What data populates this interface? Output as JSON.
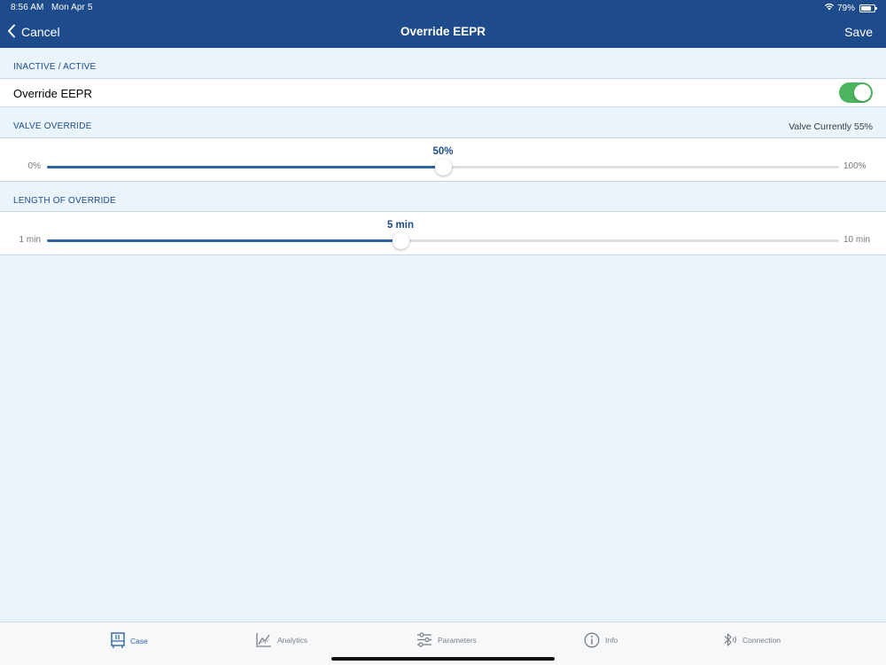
{
  "status_bar": {
    "time": "8:56 AM",
    "date": "Mon Apr 5",
    "battery": "79%",
    "battery_level": 0.79
  },
  "nav": {
    "back_label": "Cancel",
    "title": "Override EEPR",
    "save_label": "Save"
  },
  "sections": {
    "active": {
      "header": "INACTIVE / ACTIVE",
      "row_label": "Override EEPR",
      "toggle_on": true
    },
    "valve": {
      "header": "VALVE OVERRIDE",
      "status": "Valve Currently 55%",
      "slider": {
        "min_label": "0%",
        "max_label": "100%",
        "value_label": "50%",
        "fraction": 0.5
      }
    },
    "length": {
      "header": "LENGTH OF OVERRIDE",
      "slider": {
        "min_label": "1 min",
        "max_label": "10 min",
        "value_label": "5 min",
        "fraction": 0.4463
      }
    }
  },
  "tabs": [
    {
      "label": "Case",
      "icon": "case-icon",
      "active": true
    },
    {
      "label": "Analytics",
      "icon": "analytics-icon",
      "active": false
    },
    {
      "label": "Parameters",
      "icon": "parameters-icon",
      "active": false
    },
    {
      "label": "Info",
      "icon": "info-icon",
      "active": false
    },
    {
      "label": "Connection",
      "icon": "bluetooth-icon",
      "active": false
    }
  ],
  "colors": {
    "nav_bar": "#1e4b8c",
    "background": "#eaf4fc",
    "accent": "#2f64a8",
    "toggle_on": "#4cb35e"
  }
}
